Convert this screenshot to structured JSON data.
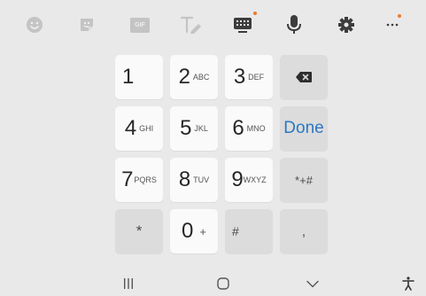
{
  "toolbar": {
    "icons": [
      "emoji-icon",
      "sticker-icon",
      "gif-icon",
      "handwriting-icon",
      "keyboard-icon",
      "microphone-icon",
      "settings-icon",
      "more-icon"
    ],
    "gif_text": "GIF",
    "notification_color": "#f07a2a"
  },
  "keypad": {
    "keys": [
      {
        "main": "1",
        "sub": ""
      },
      {
        "main": "2",
        "sub": "ABC"
      },
      {
        "main": "3",
        "sub": "DEF"
      },
      {
        "main": "backspace",
        "sub": ""
      },
      {
        "main": "4",
        "sub": "GHI"
      },
      {
        "main": "5",
        "sub": "JKL"
      },
      {
        "main": "6",
        "sub": "MNO"
      },
      {
        "main": "Done",
        "sub": ""
      },
      {
        "main": "7",
        "sub": "PQRS"
      },
      {
        "main": "8",
        "sub": "TUV"
      },
      {
        "main": "9",
        "sub": "WXYZ"
      },
      {
        "main": "*+#",
        "sub": ""
      },
      {
        "main": "*",
        "sub": ""
      },
      {
        "main": "0",
        "sub": "+"
      },
      {
        "main": "#",
        "sub": ""
      },
      {
        "main": ",",
        "sub": ""
      }
    ],
    "done_color": "#2b78c5"
  },
  "navbar": {
    "icons": [
      "recents-icon",
      "home-icon",
      "back-icon",
      "accessibility-icon"
    ]
  }
}
